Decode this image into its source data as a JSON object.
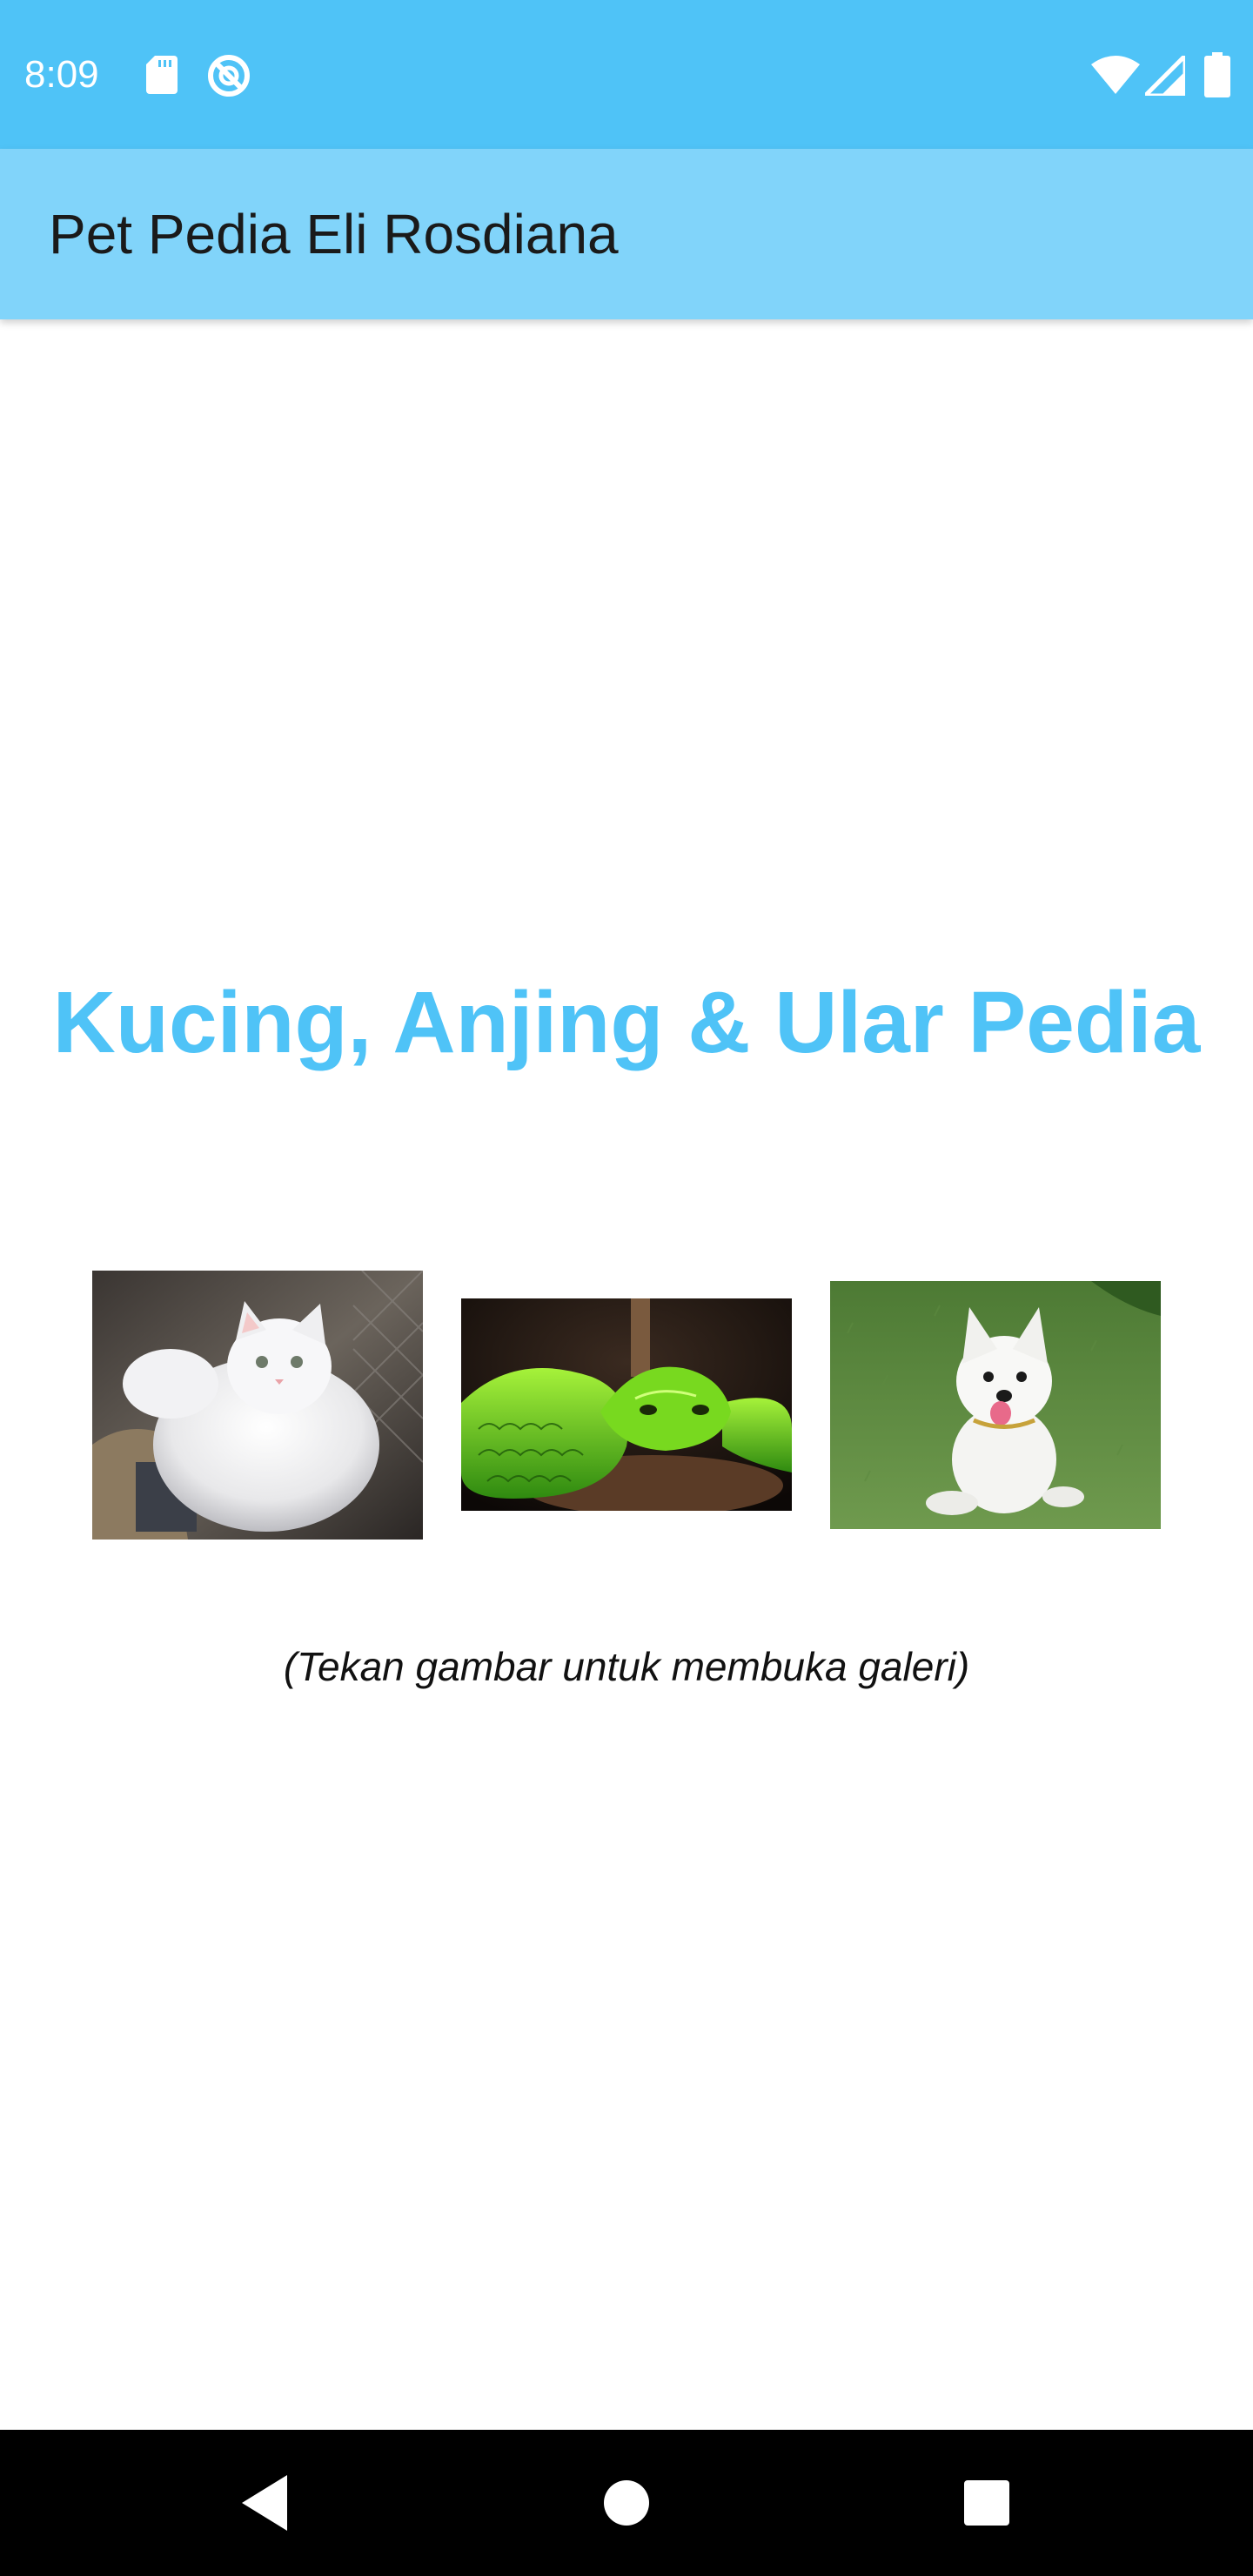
{
  "status_bar": {
    "time": "8:09",
    "icons": [
      "sd-card-icon",
      "sync-disabled-icon",
      "wifi-icon",
      "cell-signal-icon",
      "battery-icon"
    ]
  },
  "app_bar": {
    "title": "Pet Pedia Eli Rosdiana",
    "color": "#81d4fa"
  },
  "main": {
    "headline": "Kucing, Anjing & Ular Pedia",
    "headline_color": "#4fc3f7",
    "images": [
      {
        "name": "cat",
        "icon": "cat-photo"
      },
      {
        "name": "snake",
        "icon": "snake-photo"
      },
      {
        "name": "dog",
        "icon": "dog-photo"
      }
    ],
    "hint": "(Tekan gambar untuk membuka galeri)"
  },
  "nav_bar": {
    "buttons": [
      "back-icon",
      "home-icon",
      "recents-icon"
    ]
  },
  "colors": {
    "status_bar": "#4fc3f7",
    "app_bar": "#81d4fa",
    "accent": "#4fc3f7"
  }
}
